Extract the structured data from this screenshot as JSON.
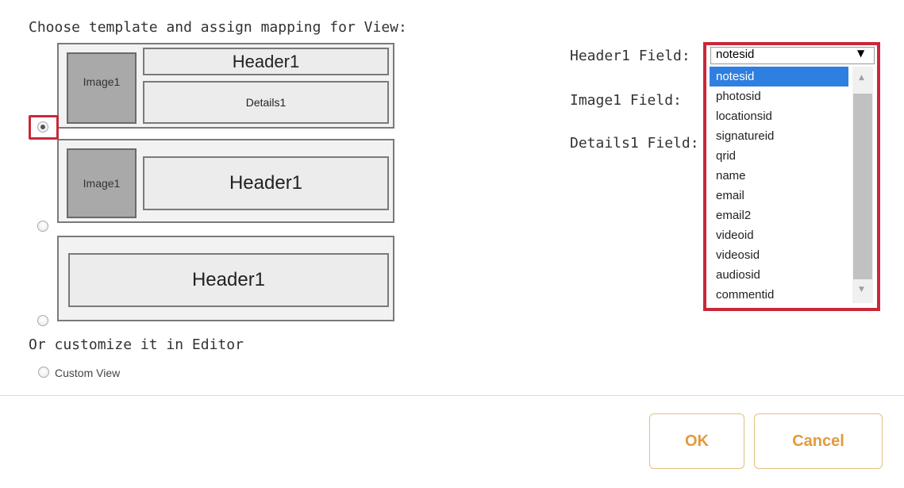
{
  "heading": "Choose template and assign mapping for View:",
  "templates": [
    {
      "image_label": "Image1",
      "header_label": "Header1",
      "details_label": "Details1",
      "selected": true
    },
    {
      "image_label": "Image1",
      "header_label": "Header1",
      "selected": false
    },
    {
      "header_label": "Header1",
      "selected": false
    }
  ],
  "customize": {
    "heading": "Or customize it in Editor",
    "option_label": "Custom View"
  },
  "fields": {
    "header1_label": "Header1 Field:",
    "image1_label": "Image1 Field:",
    "details1_label": "Details1 Field:"
  },
  "header1_select": {
    "value": "notesid",
    "options": [
      "notesid",
      "photosid",
      "locationsid",
      "signatureid",
      "qrid",
      "name",
      "email",
      "email2",
      "videoid",
      "videosid",
      "audiosid",
      "commentid"
    ],
    "highlighted_option": "notesid"
  },
  "buttons": {
    "ok": "OK",
    "cancel": "Cancel"
  },
  "colors": {
    "highlight_red": "#c9283a",
    "selected_blue": "#2e7fe0",
    "button_orange": "#e29a3d"
  }
}
